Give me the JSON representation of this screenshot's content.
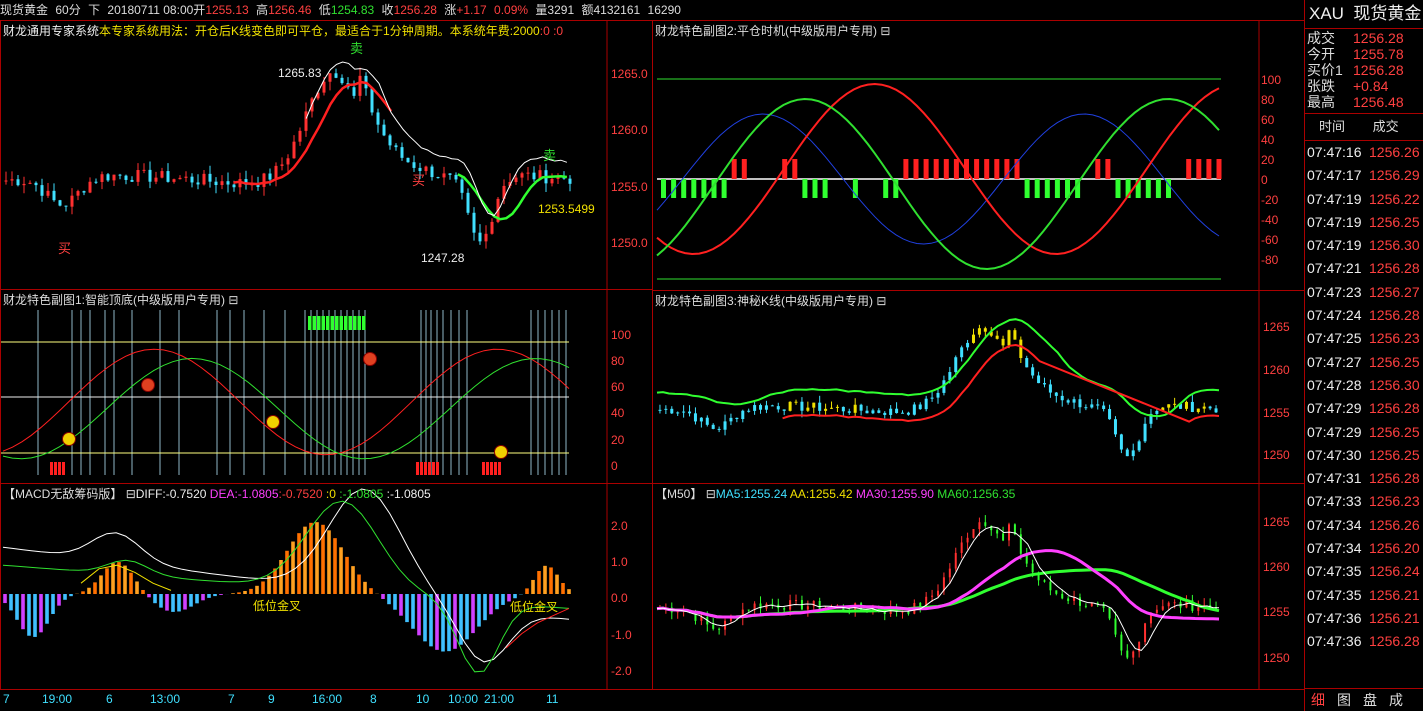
{
  "topbar": {
    "symbol": "现货黄金",
    "period": "60分",
    "dir": "下",
    "datetime": "20180711 08:00",
    "open_label": "开",
    "open": "1255.13",
    "high_label": "高",
    "high": "1256.46",
    "low_label": "低",
    "low": "1254.83",
    "close_label": "收",
    "close": "1256.28",
    "chg_label": "涨",
    "chg": "+1.17",
    "pct": "0.09%",
    "vol_label": "量",
    "vol": "3291",
    "amt_label": "额",
    "amt": "4132161",
    "extra": "16290"
  },
  "main_panel": {
    "title": "财龙通用专家系统",
    "desc": "本专家系统用法：开仓后K线变色即可平仓，最适合于1分钟周期。本系统年费:2000",
    "tail": ":0 :0",
    "labels": {
      "high": "1265.83",
      "low": "1247.28",
      "right": "1253.5499",
      "buy1": "买",
      "buy2": "买",
      "sell1": "卖",
      "sell2": "卖"
    },
    "yticks": [
      "1265.0",
      "1260.0",
      "1255.0",
      "1250.0"
    ]
  },
  "sub1": {
    "title": "财龙特色副图1:智能顶底(中级版用户专用)",
    "icon": "⊟",
    "yticks": [
      "100",
      "80",
      "60",
      "40",
      "20",
      "0"
    ]
  },
  "sub2": {
    "title": "财龙特色副图2:平仓时机(中级版用户专用)",
    "icon": "⊟",
    "yticks": [
      "100",
      "80",
      "60",
      "40",
      "20",
      "0",
      "-20",
      "-40",
      "-60",
      "-80"
    ]
  },
  "sub3": {
    "title": "财龙特色副图3:神秘K线(中级版用户专用)",
    "icon": "⊟",
    "yticks": [
      "1265",
      "1260",
      "1255",
      "1250"
    ]
  },
  "macd": {
    "title": "【MACD无敌筹码版】",
    "icon": "⊟",
    "diff": "DIFF:-0.7520",
    "dea": "DEA:-1.0805",
    "v1": ":-0.7520",
    "v2": ":0",
    "v3": ":-1.0805",
    "v4": ":-1.0805",
    "label1": "低位金叉",
    "label2": "低位金叉",
    "yticks": [
      "2.0",
      "1.0",
      "0.0",
      "-1.0",
      "-2.0"
    ]
  },
  "ma": {
    "title": "【M50】",
    "icon": "⊟",
    "ma5": "MA5:1255.24",
    "aa": "AA:1255.42",
    "ma30": "MA30:1255.90",
    "ma60": "MA60:1256.35",
    "yticks": [
      "1265",
      "1260",
      "1255",
      "1250"
    ]
  },
  "timeaxis": [
    "7",
    "19:00",
    "6",
    "13:00",
    "7",
    "9",
    "16:00",
    "8",
    "10",
    "10:00",
    "21:00",
    "11"
  ],
  "sidebar": {
    "code": "XAU",
    "name": "现货黄金",
    "quotes": [
      {
        "k": "成交",
        "v": "1256.28"
      },
      {
        "k": "今开",
        "v": "1255.78"
      },
      {
        "k": "买价1",
        "v": "1256.28"
      },
      {
        "k": "张跌",
        "v": "+0.84"
      },
      {
        "k": "最高",
        "v": "1256.48"
      }
    ],
    "tick_header": {
      "time": "时间",
      "price": "成交"
    },
    "ticks": [
      {
        "t": "07:47:16",
        "p": "1256.26"
      },
      {
        "t": "07:47:17",
        "p": "1256.29"
      },
      {
        "t": "07:47:19",
        "p": "1256.22"
      },
      {
        "t": "07:47:19",
        "p": "1256.25"
      },
      {
        "t": "07:47:19",
        "p": "1256.30"
      },
      {
        "t": "07:47:21",
        "p": "1256.28"
      },
      {
        "t": "07:47:23",
        "p": "1256.27"
      },
      {
        "t": "07:47:24",
        "p": "1256.28"
      },
      {
        "t": "07:47:25",
        "p": "1256.23"
      },
      {
        "t": "07:47:27",
        "p": "1256.25"
      },
      {
        "t": "07:47:28",
        "p": "1256.30"
      },
      {
        "t": "07:47:29",
        "p": "1256.28"
      },
      {
        "t": "07:47:29",
        "p": "1256.25"
      },
      {
        "t": "07:47:30",
        "p": "1256.25"
      },
      {
        "t": "07:47:31",
        "p": "1256.28"
      },
      {
        "t": "07:47:33",
        "p": "1256.23"
      },
      {
        "t": "07:47:34",
        "p": "1256.26"
      },
      {
        "t": "07:47:34",
        "p": "1256.20"
      },
      {
        "t": "07:47:35",
        "p": "1256.24"
      },
      {
        "t": "07:47:35",
        "p": "1256.21"
      },
      {
        "t": "07:47:36",
        "p": "1256.21"
      },
      {
        "t": "07:47:36",
        "p": "1256.28"
      }
    ],
    "tabs": [
      "细",
      "图",
      "盘",
      "成"
    ]
  }
}
